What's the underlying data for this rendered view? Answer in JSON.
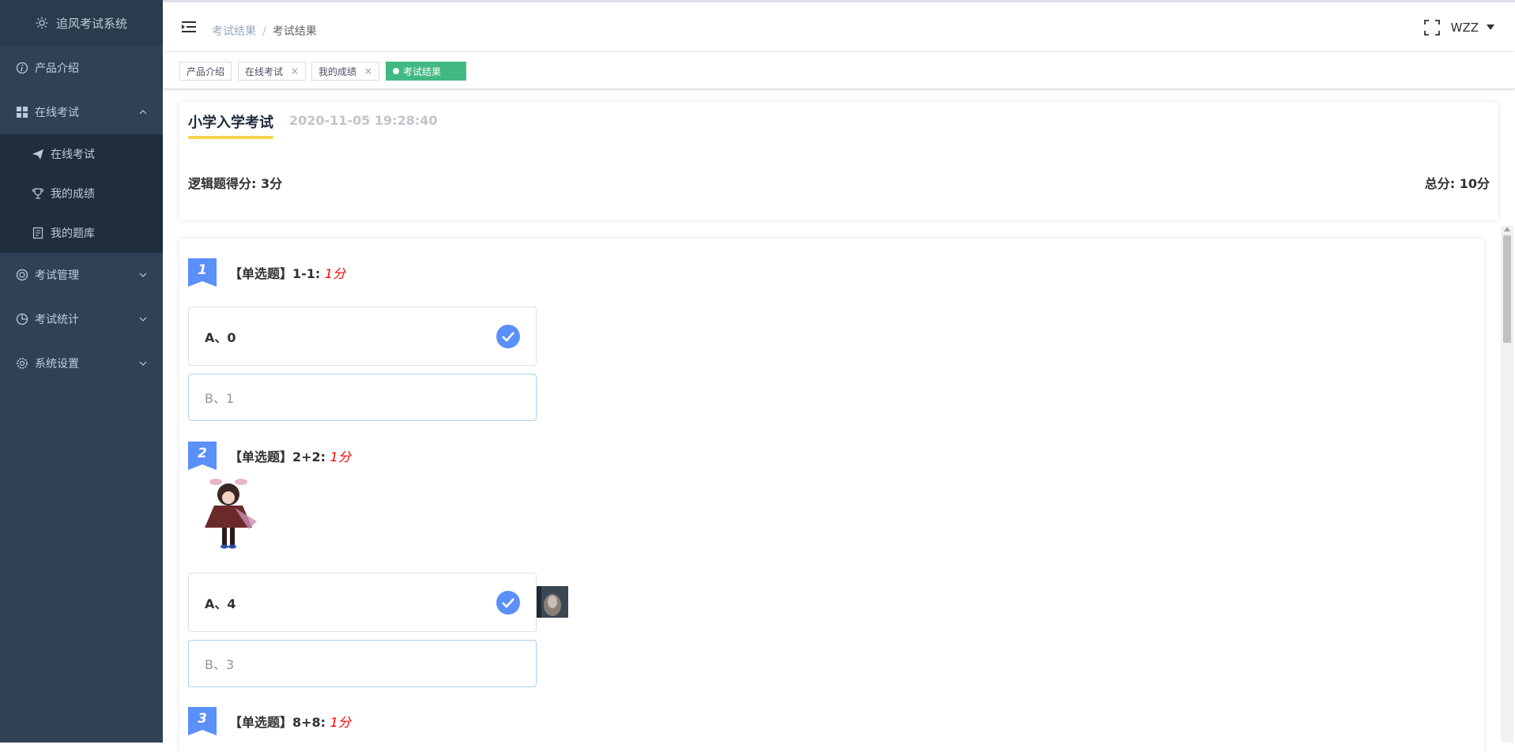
{
  "app": {
    "title": "追风考试系统"
  },
  "sidebar": {
    "items": [
      {
        "label": "产品介绍",
        "icon": "info-icon"
      },
      {
        "label": "在线考试",
        "icon": "grid-icon",
        "expanded": true,
        "children": [
          {
            "label": "在线考试",
            "icon": "send-icon"
          },
          {
            "label": "我的成绩",
            "icon": "trophy-icon"
          },
          {
            "label": "我的题库",
            "icon": "book-icon"
          }
        ]
      },
      {
        "label": "考试管理",
        "icon": "lifebuoy-icon"
      },
      {
        "label": "考试统计",
        "icon": "pie-icon"
      },
      {
        "label": "系统设置",
        "icon": "gear-icon"
      }
    ]
  },
  "navbar": {
    "breadcrumb": [
      "考试结果",
      "考试结果"
    ],
    "user": "WZZ"
  },
  "tags": [
    {
      "label": "产品介绍",
      "closable": false,
      "active": false
    },
    {
      "label": "在线考试",
      "closable": true,
      "active": false
    },
    {
      "label": "我的成绩",
      "closable": true,
      "active": false
    },
    {
      "label": "考试结果",
      "closable": false,
      "active": true
    }
  ],
  "exam": {
    "title": "小学入学考试",
    "time": "2020-11-05 19:28:40",
    "logic_score": "逻辑题得分: 3分",
    "total_score": "总分: 10分"
  },
  "questions": [
    {
      "number": "1",
      "title": "【单选题】1-1: ",
      "score": "1分",
      "options": [
        {
          "text": "A、0",
          "correct": true
        },
        {
          "text": "B、1",
          "correct": false
        }
      ]
    },
    {
      "number": "2",
      "title": "【单选题】2+2: ",
      "score": "1分",
      "options": [
        {
          "text": "A、4",
          "correct": true
        },
        {
          "text": "B、3",
          "correct": false
        }
      ]
    },
    {
      "number": "3",
      "title": "【单选题】8+8: ",
      "score": "1分",
      "options": []
    }
  ],
  "colors": {
    "sidebar": "#304156",
    "accent": "#42b983",
    "check": "#5b8ff9",
    "underline": "#f8d24a",
    "score": "#ff0000"
  }
}
